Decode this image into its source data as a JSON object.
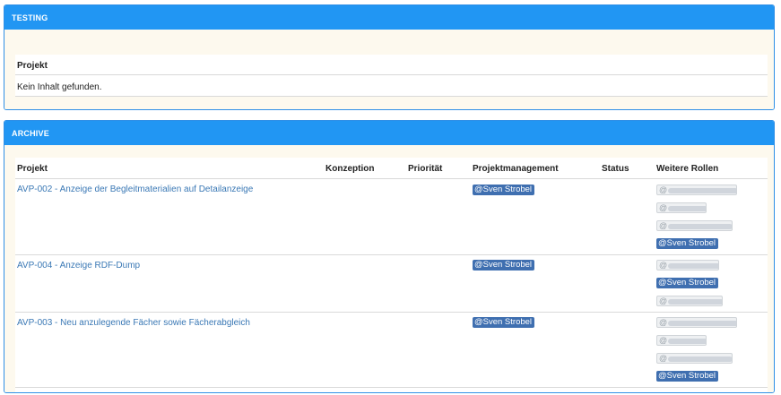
{
  "testing": {
    "title": "TESTING",
    "column": "Projekt",
    "empty": "Kein Inhalt gefunden."
  },
  "archive": {
    "title": "ARCHIVE",
    "columns": [
      "Projekt",
      "Konzeption",
      "Priorität",
      "Projektmanagement",
      "Status",
      "Weitere Rollen"
    ],
    "rows": [
      {
        "project": "AVP-002 - Anzeige der Begleitmaterialien auf Detailanzeige",
        "manager": "@Sven Strobel",
        "roles": [
          {
            "text": "@",
            "redacted": true
          },
          {
            "text": "@",
            "redacted": true
          },
          {
            "text": "@",
            "redacted": true
          },
          {
            "text": "@Sven Strobel",
            "redacted": false
          }
        ]
      },
      {
        "project": "AVP-004 - Anzeige RDF-Dump",
        "manager": "@Sven Strobel",
        "roles": [
          {
            "text": "@",
            "redacted": true
          },
          {
            "text": "@Sven Strobel",
            "redacted": false
          },
          {
            "text": "@",
            "redacted": true
          }
        ]
      },
      {
        "project": "AVP-003 - Neu anzulegende Fächer sowie Fächerabgleich",
        "manager": "@Sven Strobel",
        "roles": [
          {
            "text": "@",
            "redacted": true
          },
          {
            "text": "@",
            "redacted": true
          },
          {
            "text": "@",
            "redacted": true
          },
          {
            "text": "@Sven Strobel",
            "redacted": false
          }
        ]
      }
    ]
  },
  "colors": {
    "header": "#2196f3",
    "tag": "#3f6fb0",
    "link": "#3a78b5",
    "cream": "#fdf9ee"
  }
}
